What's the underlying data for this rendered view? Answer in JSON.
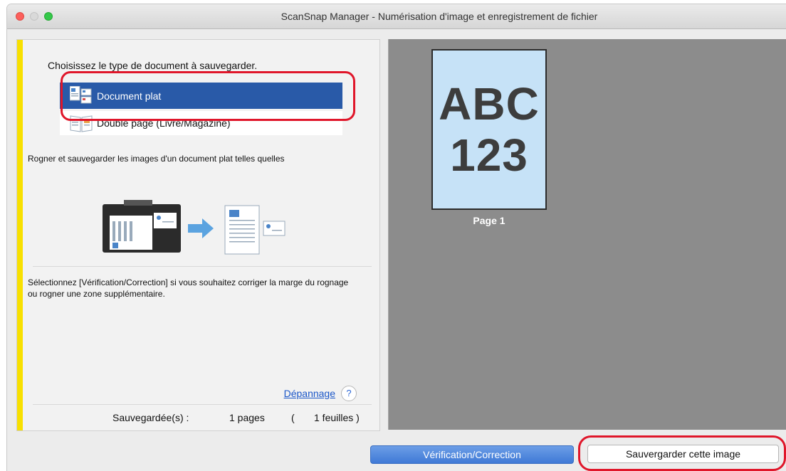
{
  "window": {
    "title": "ScanSnap Manager - Numérisation d'image et enregistrement de fichier"
  },
  "left_panel": {
    "instruction": "Choisissez le type de document à sauvegarder.",
    "options": [
      {
        "label": "Document plat",
        "selected": true,
        "icon": "flat-document-icon"
      },
      {
        "label": "Double page (Livre/Magazine)",
        "selected": false,
        "icon": "book-double-page-icon"
      }
    ],
    "description": "Rogner et sauvegarder les images d'un document plat telles quelles",
    "note": "Sélectionnez [Vérification/Correction] si vous souhaitez corriger la marge du rognage ou rogner une zone supplémentaire.",
    "help": {
      "link": "Dépannage",
      "icon": "?"
    },
    "saved": {
      "label": "Sauvegardée(s) :",
      "pages": "1 pages",
      "open": "(",
      "sheets": "1 feuilles )"
    }
  },
  "preview": {
    "page_line1": "ABC",
    "page_line2": "123",
    "page_label": "Page 1"
  },
  "buttons": {
    "verify": "Vérification/Correction",
    "save": "Sauvergarder cette image"
  },
  "colors": {
    "selection": "#295aa8",
    "accent_bar": "#f8e000",
    "annotation": "#e0162a",
    "preview_bg": "#8c8c8c",
    "page_bg": "#c6e2f7"
  }
}
